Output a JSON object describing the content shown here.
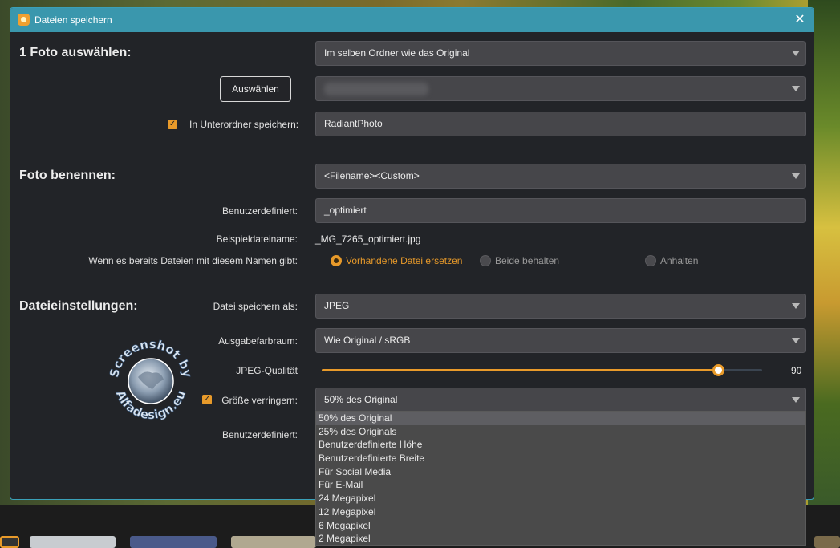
{
  "window": {
    "title": "Dateien speichern",
    "close_glyph": "✕"
  },
  "section1": {
    "title": "1 Foto auswählen:",
    "folder_select_value": "Im selben Ordner wie das Original",
    "choose_button": "Auswählen",
    "subfolder_checkbox_label": "In Unterordner speichern:",
    "subfolder_value": "RadiantPhoto"
  },
  "section2": {
    "title": "Foto benennen:",
    "naming_select_value": "<Filename><Custom>",
    "custom_label": "Benutzerdefiniert:",
    "custom_value": "_optimiert",
    "example_label": "Beispieldateiname:",
    "example_value": "_MG_7265_optimiert.jpg",
    "conflict_label": "Wenn es bereits Dateien mit diesem Namen gibt:",
    "conflict_options": [
      "Vorhandene Datei ersetzen",
      "Beide behalten",
      "Anhalten"
    ]
  },
  "section3": {
    "title": "Dateieinstellungen:",
    "format_label": "Datei speichern als:",
    "format_value": "JPEG",
    "colorspace_label": "Ausgabefarbraum:",
    "colorspace_value": "Wie Original / sRGB",
    "quality_label": "JPEG-Qualität",
    "quality_value": "90",
    "quality_fraction": 0.9,
    "resize_label": "Größe verringern:",
    "resize_value": "50% des Original",
    "custom_label": "Benutzerdefiniert:",
    "resize_options": [
      "50% des Original",
      "25% des Originals",
      "Benutzerdefinierte Höhe",
      "Benutzerdefinierte Breite",
      "Für Social Media",
      "Für E-Mail",
      "24 Megapixel",
      "12 Megapixel",
      "6 Megapixel",
      "2 Megapixel"
    ]
  },
  "watermark": {
    "top_text": "Screenshot by",
    "bottom_text": "Alfadesign.eu"
  },
  "colors": {
    "accent": "#e89a2a",
    "titlebar": "#3a97ad",
    "dialog_bg": "#222428",
    "field_bg": "#46464a"
  }
}
